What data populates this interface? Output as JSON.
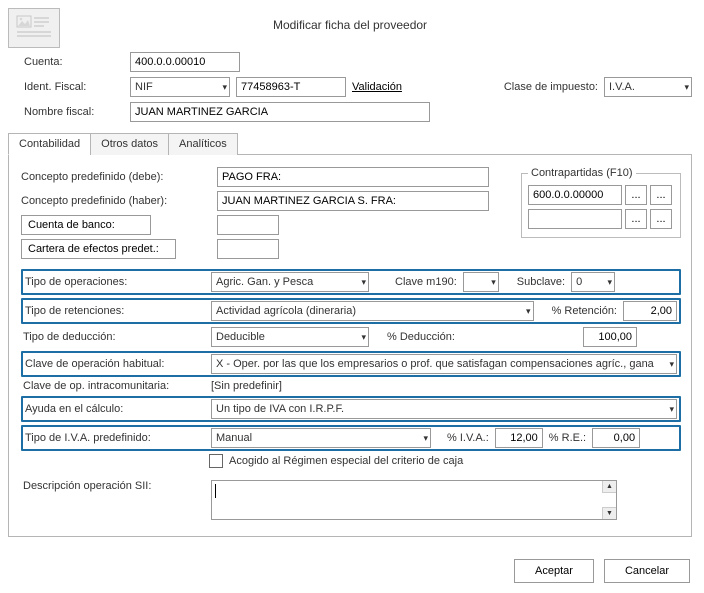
{
  "title": "Modificar ficha del proveedor",
  "header": {
    "cuenta_label": "Cuenta:",
    "cuenta_value": "400.0.0.00010",
    "ident_fiscal_label": "Ident. Fiscal:",
    "ident_tipo": "NIF",
    "ident_numero": "77458963-T",
    "validacion_link": "Validación",
    "clase_impuesto_label": "Clase de impuesto:",
    "clase_impuesto_value": "I.V.A.",
    "nombre_fiscal_label": "Nombre fiscal:",
    "nombre_fiscal_value": "JUAN MARTINEZ GARCIA"
  },
  "tabs": {
    "contabilidad": "Contabilidad",
    "otros": "Otros datos",
    "analiticos": "Analíticos"
  },
  "contab": {
    "concepto_debe_label": "Concepto predefinido (debe):",
    "concepto_debe_value": "PAGO FRA:",
    "concepto_haber_label": "Concepto predefinido (haber):",
    "concepto_haber_value": "JUAN MARTINEZ GARCIA S. FRA:",
    "cuenta_banco_label": "Cuenta de banco:",
    "cuenta_banco_value": "",
    "cartera_label": "Cartera de efectos predet.:",
    "cartera_value": "",
    "contrapartidas_title": "Contrapartidas (F10)",
    "contrapartida_value": "600.0.0.00000",
    "ellipsis": "...",
    "tipo_operaciones_label": "Tipo de operaciones:",
    "tipo_operaciones_value": "Agric. Gan. y Pesca",
    "clave_m190_label": "Clave m190:",
    "clave_m190_value": "",
    "subclave_label": "Subclave:",
    "subclave_value": "0",
    "tipo_retenciones_label": "Tipo de retenciones:",
    "tipo_retenciones_value": "Actividad agrícola (dineraria)",
    "pct_retencion_label": "% Retención:",
    "pct_retencion_value": "2,00",
    "tipo_deduccion_label": "Tipo de deducción:",
    "tipo_deduccion_value": "Deducible",
    "pct_deduccion_label": "% Deducción:",
    "pct_deduccion_value": "100,00",
    "clave_hab_label": "Clave de operación habitual:",
    "clave_hab_value": "X - Oper. por las que los empresarios o prof. que satisfagan compensaciones agríc., gana",
    "clave_intra_label": "Clave de op. intracomunitaria:",
    "clave_intra_value": "[Sin predefinir]",
    "ayuda_label": "Ayuda en el cálculo:",
    "ayuda_value": "Un tipo de IVA con I.R.P.F.",
    "tipo_iva_label": "Tipo de I.V.A. predefinido:",
    "tipo_iva_value": "Manual",
    "pct_iva_label": "% I.V.A.:",
    "pct_iva_value": "12,00",
    "pct_re_label": "% R.E.:",
    "pct_re_value": "0,00",
    "acogido_label": "Acogido al Régimen especial del criterio de caja",
    "descripcion_sii_label": "Descripción operación SII:",
    "descripcion_sii_value": ""
  },
  "footer": {
    "aceptar": "Aceptar",
    "cancelar": "Cancelar"
  }
}
